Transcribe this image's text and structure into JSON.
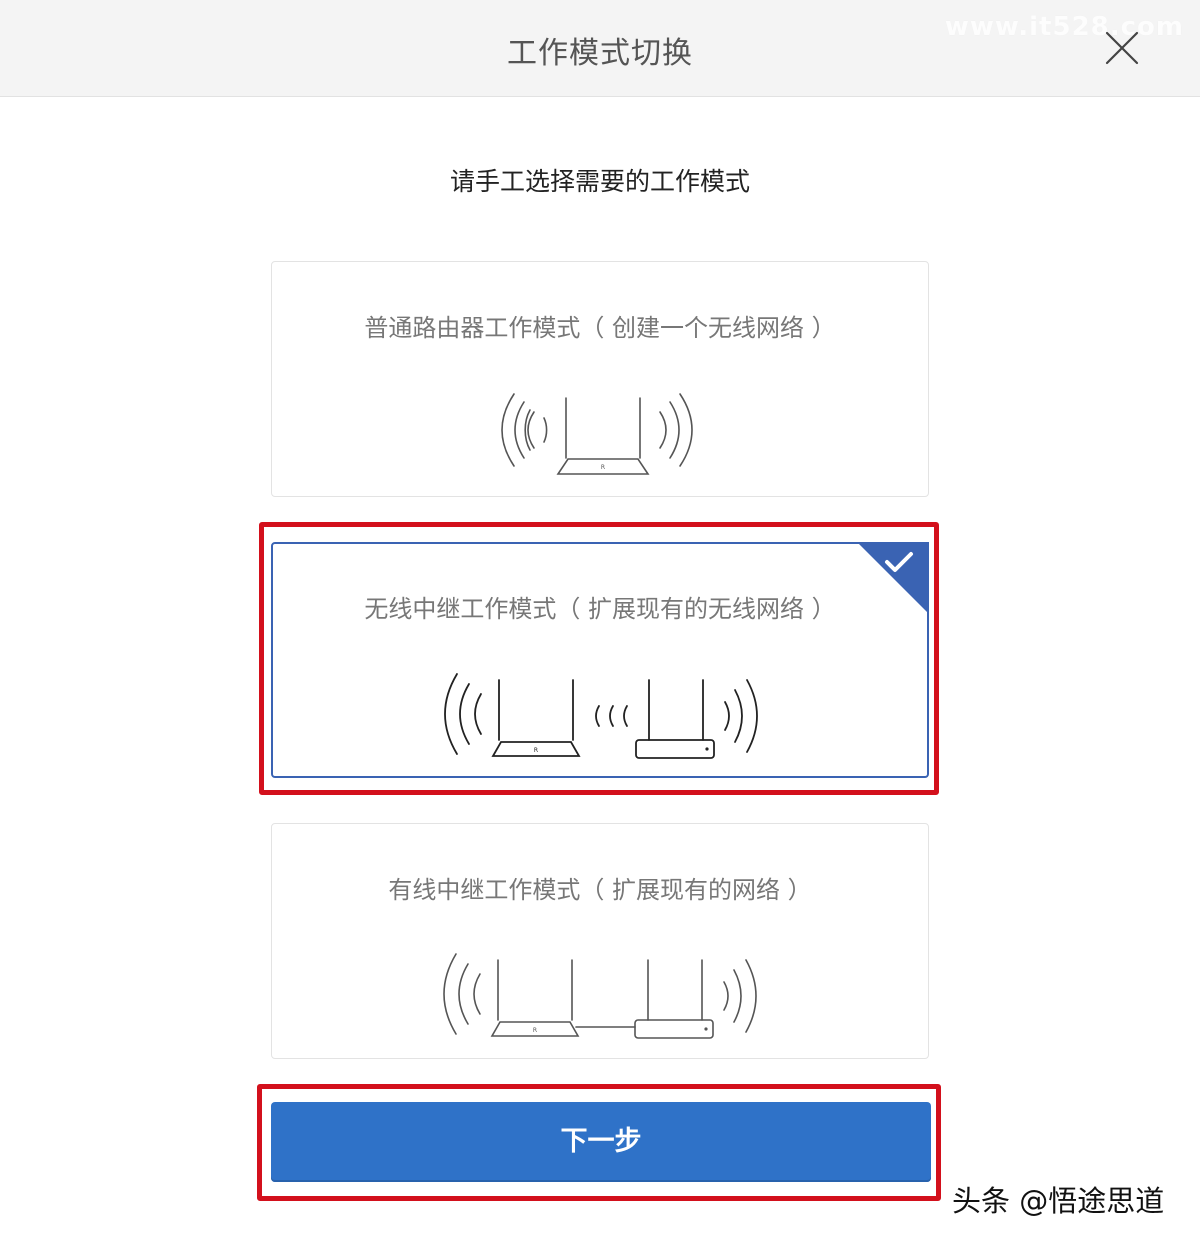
{
  "dialog": {
    "title": "工作模式切换",
    "subtitle": "请手工选择需要的工作模式",
    "watermark_top": "www.it528.com"
  },
  "modes": [
    {
      "title": "普通路由器工作模式（ 创建一个无线网络 ）",
      "selected": false
    },
    {
      "title": "无线中继工作模式（ 扩展现有的无线网络 ）",
      "selected": true
    },
    {
      "title": "有线中继工作模式（ 扩展现有的网络 ）",
      "selected": false
    }
  ],
  "next_button": {
    "label": "下一步"
  },
  "footer_watermark": "头条 @悟途思道",
  "colors": {
    "primary": "#2f72c8",
    "selected_border": "#3a63b3",
    "highlight": "#d3101c",
    "header_bg": "#f4f4f4"
  }
}
